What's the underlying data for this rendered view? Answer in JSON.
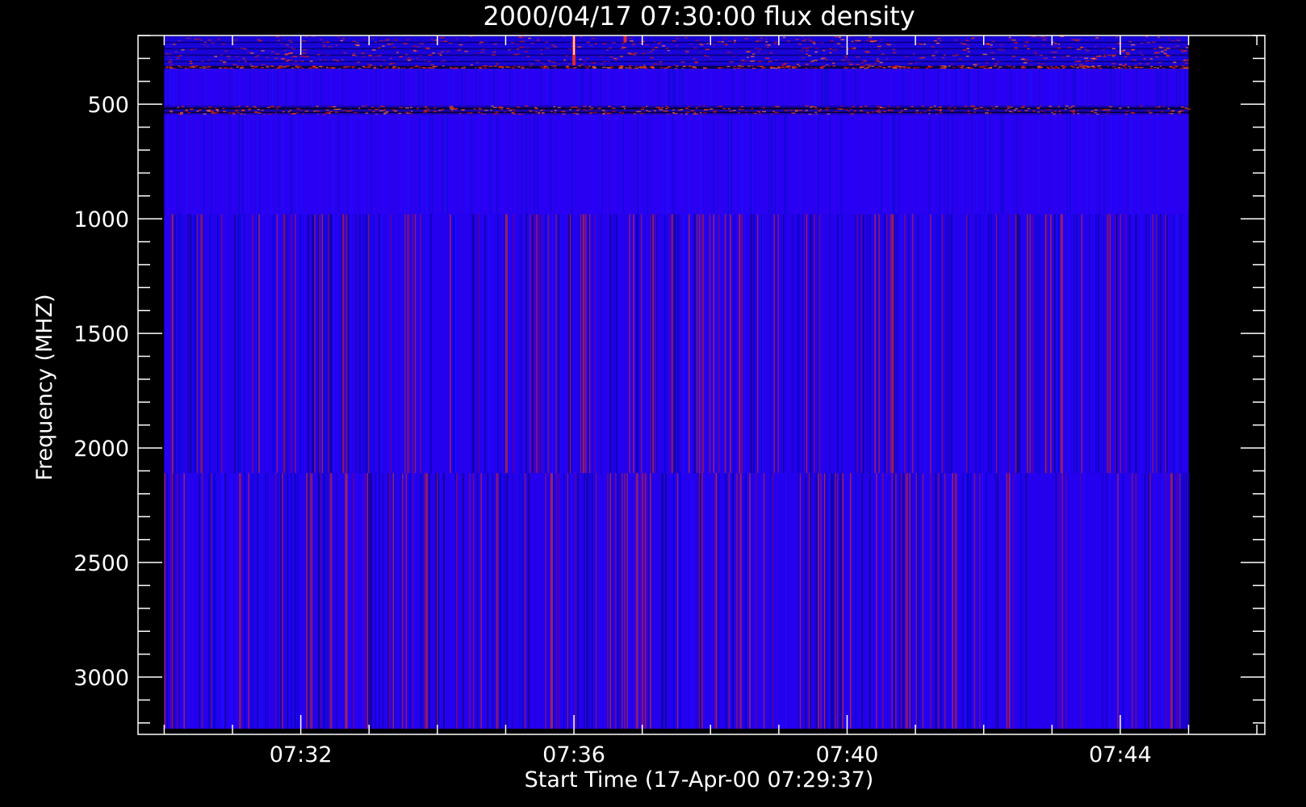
{
  "chart_data": {
    "type": "heatmap",
    "title": "2000/04/17 07:30:00 flux density",
    "xlabel": "Start Time (17-Apr-00 07:29:37)",
    "ylabel": "Frequency (MHZ)",
    "x_range": [
      "07:29:37",
      "07:46:07"
    ],
    "x_data_range": [
      "07:30:00",
      "07:45:00"
    ],
    "x_ticks": [
      "07:32",
      "07:36",
      "07:40",
      "07:44"
    ],
    "x_minor_tick_step_min": 1,
    "y_range": [
      200,
      3250
    ],
    "y_data_range": [
      200,
      3225
    ],
    "y_reversed": true,
    "y_ticks": [
      500,
      1000,
      1500,
      2000,
      2500,
      3000
    ],
    "y_minor_tick_step": 100,
    "colormap": {
      "low": "#000010",
      "mid": "#2a00ff",
      "high": "#ff2a00"
    },
    "background_color": "#2800ee",
    "frequency_bands": [
      {
        "from": 200,
        "to": 330,
        "level": "mixed",
        "note": "noisy blue/red speckle, brighter red near 07:44-07:45"
      },
      {
        "from": 330,
        "to": 345,
        "level": "enhanced",
        "note": "thin dark/red line"
      },
      {
        "from": 345,
        "to": 505,
        "level": "background"
      },
      {
        "from": 505,
        "to": 545,
        "level": "enhanced",
        "note": "dark lines with red/orange speckle"
      },
      {
        "from": 545,
        "to": 980,
        "level": "background",
        "note": "smooth blue"
      },
      {
        "from": 980,
        "to": 2110,
        "level": "striped",
        "note": "vertical red/dark stripes"
      },
      {
        "from": 2110,
        "to": 3225,
        "level": "striped",
        "note": "vertical red/dark stripes"
      }
    ],
    "events": [
      {
        "time": "07:36:00",
        "freq_from": 200,
        "freq_to": 330,
        "note": "short red burst"
      },
      {
        "time": "07:36:45",
        "freq_from": 200,
        "freq_to": 230,
        "note": "small red spot"
      }
    ]
  }
}
